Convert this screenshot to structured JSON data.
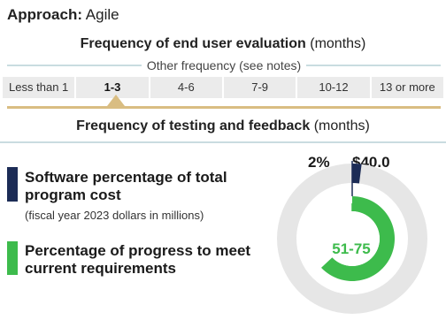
{
  "approach": {
    "label": "Approach:",
    "value": "Agile"
  },
  "evaluation": {
    "title": "Frequency of end user evaluation",
    "unit": "(months)",
    "other": "Other frequency (see notes)",
    "options": [
      "Less than 1",
      "1-3",
      "4-6",
      "7-9",
      "10-12",
      "13 or more"
    ],
    "selected": "1-3"
  },
  "testing": {
    "title": "Frequency of testing and feedback",
    "unit": "(months)"
  },
  "software": {
    "label": "Software percentage of total program cost",
    "sublabel": "(fiscal year 2023 dollars in millions)",
    "percent_text": "2%",
    "percent_value": 2,
    "cost_text": "$40.0"
  },
  "progress": {
    "label": "Percentage of progress to meet current requirements",
    "range_text": "51-75",
    "range_low": 51,
    "range_high": 75
  },
  "colors": {
    "navy": "#1c2c56",
    "green": "#3dbb4c",
    "gold": "#d9bd82",
    "light_gray": "#ebebeb",
    "teal_line": "#c9dce0"
  }
}
